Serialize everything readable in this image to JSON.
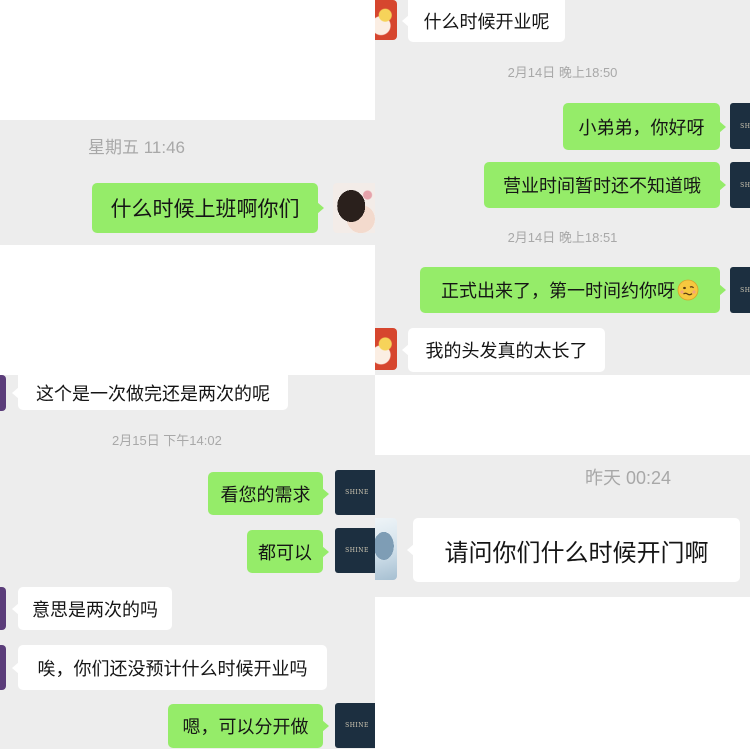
{
  "colors": {
    "bubble_green": "#95ec69",
    "bubble_white": "#ffffff",
    "chat_bg": "#ededed",
    "timestamp": "#a8a8a8",
    "shop_avatar": "#1c2f40"
  },
  "avatars": {
    "shop_logo_text": "SHINE"
  },
  "top_left": {
    "items": [
      {
        "type": "timestamp",
        "text": "星期五 11:46"
      },
      {
        "type": "message",
        "side": "sent",
        "text": "什么时候上班啊你们"
      }
    ]
  },
  "top_right": {
    "items": [
      {
        "type": "message",
        "side": "received",
        "text": "什么时候开业呢"
      },
      {
        "type": "timestamp",
        "text": "2月14日 晚上18:50"
      },
      {
        "type": "message",
        "side": "sent",
        "text": "小弟弟，你好呀"
      },
      {
        "type": "message",
        "side": "sent",
        "text": "营业时间暂时还不知道哦"
      },
      {
        "type": "timestamp",
        "text": "2月14日 晚上18:51"
      },
      {
        "type": "message",
        "side": "sent",
        "text": "正式出来了，第一时间约你呀",
        "emoji_icon": "woozy-face-icon"
      },
      {
        "type": "message",
        "side": "received",
        "text": "我的头发真的太长了"
      }
    ]
  },
  "bottom_left": {
    "items": [
      {
        "type": "message",
        "side": "received",
        "text": "这个是一次做完还是两次的呢"
      },
      {
        "type": "timestamp",
        "text": "2月15日 下午14:02"
      },
      {
        "type": "message",
        "side": "sent",
        "text": "看您的需求"
      },
      {
        "type": "message",
        "side": "sent",
        "text": "都可以"
      },
      {
        "type": "message",
        "side": "received",
        "text": "意思是两次的吗"
      },
      {
        "type": "message",
        "side": "received",
        "text": "唉，你们还没预计什么时候开业吗"
      },
      {
        "type": "message",
        "side": "sent",
        "text": "嗯，可以分开做"
      }
    ]
  },
  "bottom_right": {
    "items": [
      {
        "type": "timestamp",
        "text": "昨天 00:24"
      },
      {
        "type": "message",
        "side": "received",
        "text": "请问你们什么时候开门啊"
      }
    ]
  }
}
